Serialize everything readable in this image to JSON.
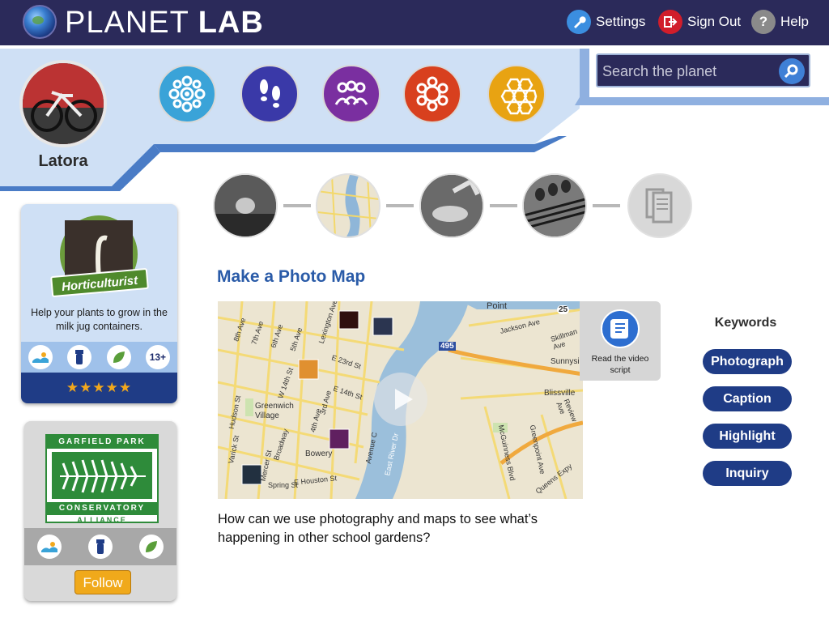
{
  "header": {
    "logo_light": "PLANET ",
    "logo_bold": "LAB",
    "settings": "Settings",
    "sign_out": "Sign Out",
    "help": "Help",
    "help_glyph": "?"
  },
  "profile": {
    "name": "Latora"
  },
  "activity_icons": [
    "observe-icon",
    "footsteps-icon",
    "group-icon",
    "flower-icon",
    "hexagons-icon"
  ],
  "search": {
    "placeholder": "Search the planet"
  },
  "badge_card": {
    "badge_label": "Horticulturist",
    "description": "Help your plants to grow in the milk jug containers.",
    "age_label": "13+",
    "rating_stars": 5,
    "stars_text": "★★★★★"
  },
  "partner_card": {
    "logo_top": "GARFIELD PARK",
    "logo_bottom1": "CONSERVATORY",
    "logo_bottom2": "ALLIANCE",
    "follow": "Follow"
  },
  "steps": [
    "seedling-step",
    "map-step",
    "basket-step",
    "plants-step",
    "document-step"
  ],
  "main": {
    "title": "Make a Photo Map",
    "video_script": "Read the video script",
    "question": "How can we use photography and maps to see what’s happening in other school gardens?",
    "map_labels": [
      "Point",
      "25",
      "495",
      "Greenwich Village",
      "Bowery",
      "Sunnysi",
      "Blissville",
      "Jackson Ave",
      "Skillman Ave",
      "E 23rd St",
      "E 14th St",
      "W 14th St",
      "3rd Ave",
      "4th Ave",
      "5th Ave",
      "6th Ave",
      "7th Ave",
      "8th Ave",
      "Broadway",
      "Lexington Ave",
      "Varick St",
      "Hudson St",
      "E Houston St",
      "Mercer St",
      "Spring St",
      "Avenue C",
      "East River Dr",
      "McGuinness Blvd",
      "Greenpoint Ave",
      "Queens Expy",
      "Review Ave"
    ]
  },
  "keywords": {
    "title": "Keywords",
    "items": [
      "Photograph",
      "Caption",
      "Highlight",
      "Inquiry"
    ]
  },
  "colors": {
    "navy": "#2b2a5a",
    "light_blue": "#cfe0f5",
    "dark_blue": "#1f3c86",
    "title_blue": "#2a5ba8",
    "orange": "#f0a91b",
    "green": "#2e8b3a"
  }
}
